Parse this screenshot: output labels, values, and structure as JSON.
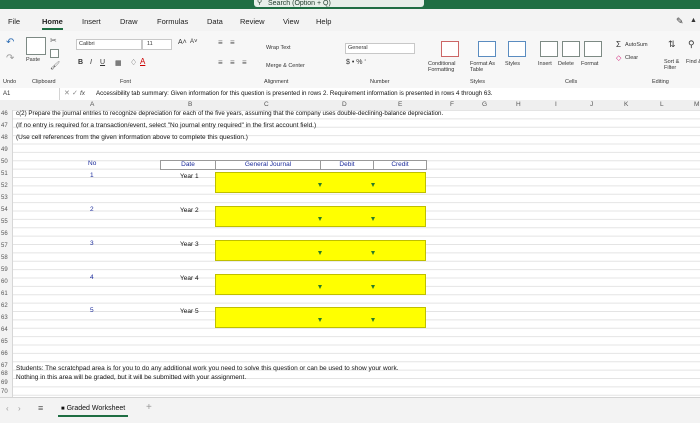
{
  "title_bar": {
    "search_label": "Search (Option + Q)"
  },
  "tabs": [
    "File",
    "Home",
    "Insert",
    "Draw",
    "Formulas",
    "Data",
    "Review",
    "View",
    "Help"
  ],
  "ribbon": {
    "paste": "Paste",
    "clipboard": "Clipboard",
    "font_name": "Calibri",
    "font_size": "11",
    "font_group": "Font",
    "wrap_text": "Wrap Text",
    "merge_center": "Merge & Center",
    "alignment": "Alignment",
    "number_format": "General",
    "number": "Number",
    "conditional_formatting": "Conditional Formatting",
    "format_as_table": "Format As Table",
    "styles": "Styles",
    "styles_group": "Styles",
    "insert": "Insert",
    "delete": "Delete",
    "format": "Format",
    "cells": "Cells",
    "autosum": "AutoSum",
    "clear": "Clear",
    "sort_filter": "Sort & Filter",
    "find_select": "Find & Select",
    "editing": "Editing",
    "undo": "Undo"
  },
  "formula_bar": {
    "name_box": "A1",
    "fx": "fx",
    "text": "Accessibility tab summary: Given information for this question is presented in rows 2. Requirement information is presented in rows 4 through 63."
  },
  "columns": [
    "A",
    "B",
    "C",
    "D",
    "E",
    "F",
    "G",
    "H",
    "I",
    "J",
    "K",
    "L",
    "M"
  ],
  "rows": [
    "46",
    "47",
    "48",
    "49",
    "50",
    "51",
    "52",
    "53",
    "54",
    "55",
    "56",
    "57",
    "58",
    "59",
    "60",
    "61",
    "62",
    "63",
    "64",
    "65",
    "66",
    "67",
    "68",
    "69",
    "70"
  ],
  "sheet": {
    "line1": "c(2) Prepare the journal entries to recognize depreciation for each of the five years, assuming that the company uses double-declining-balance depreciation.",
    "line2": "(If no entry is required for a transaction/event, select \"No journal entry required\" in the first account field.)",
    "line3": "(Use cell references from the given information above to complete this question.)",
    "headers": {
      "no": "No",
      "date": "Date",
      "general_journal": "General Journal",
      "debit": "Debit",
      "credit": "Credit"
    },
    "entries": [
      {
        "no": "1",
        "date": "Year 1"
      },
      {
        "no": "2",
        "date": "Year 2"
      },
      {
        "no": "3",
        "date": "Year 3"
      },
      {
        "no": "4",
        "date": "Year 4"
      },
      {
        "no": "5",
        "date": "Year 5"
      }
    ],
    "scratch1": "Students: The scratchpad area is for you to do any additional work you need to solve this question or can be used to show your work.",
    "scratch2": "Nothing in this area will be graded, but it will be submitted with your assignment."
  },
  "sheet_tabs": [
    "Graded Worksheet"
  ],
  "add_sheet": "+"
}
